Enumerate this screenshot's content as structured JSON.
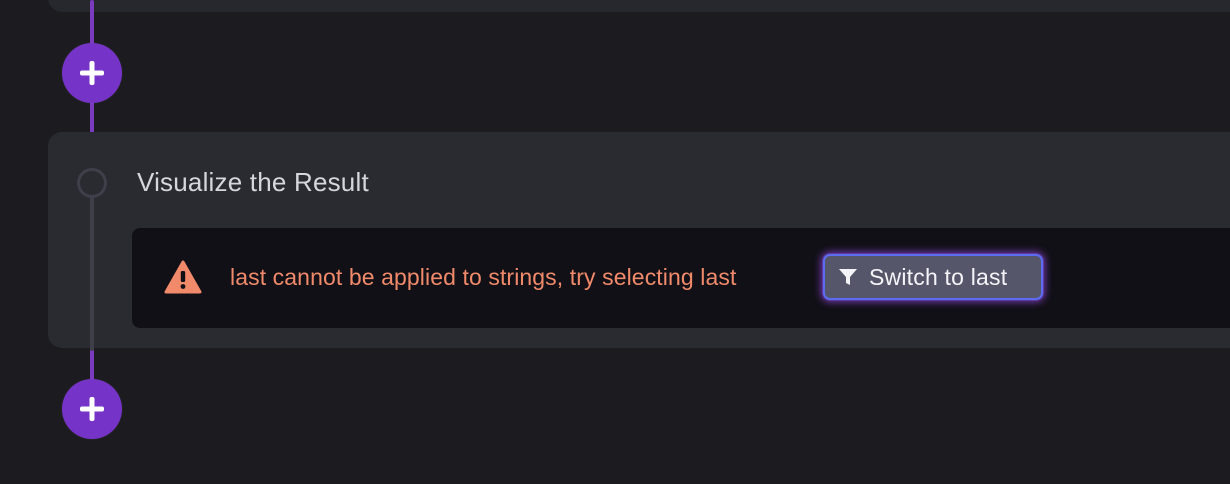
{
  "step": {
    "title": "Visualize the Result"
  },
  "error": {
    "message": "last cannot be applied to strings, try selecting last",
    "action_label": "Switch to last"
  },
  "icons": {
    "add": "plus-icon",
    "warning": "warning-triangle-icon",
    "filter": "filter-funnel-icon"
  },
  "colors": {
    "accent": "#7633c7",
    "error_text": "#f08a6a",
    "background": "#1b1b20",
    "card": "#2a2a31"
  }
}
